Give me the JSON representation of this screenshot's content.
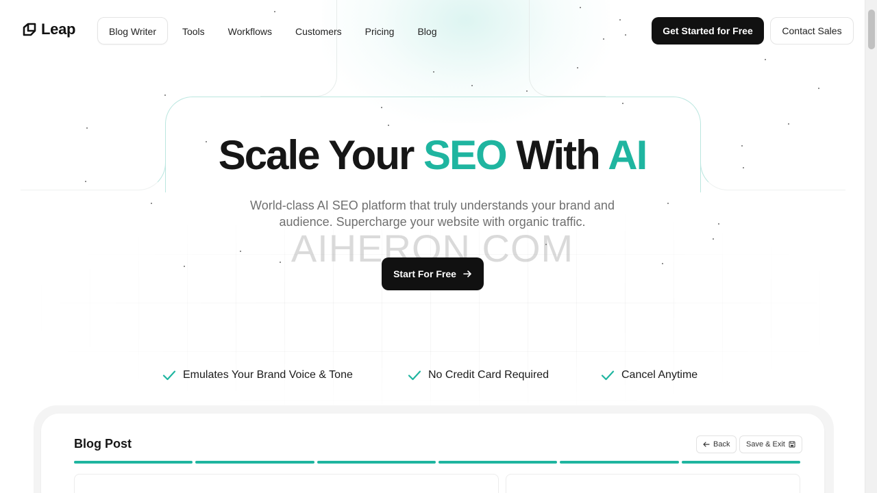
{
  "brand": {
    "name": "Leap",
    "accent_color": "#1fb5a0",
    "dark_color": "#111111"
  },
  "nav": {
    "items": [
      {
        "label": "Blog Writer"
      },
      {
        "label": "Tools"
      },
      {
        "label": "Workflows"
      },
      {
        "label": "Customers"
      },
      {
        "label": "Pricing"
      },
      {
        "label": "Blog"
      }
    ],
    "active_item": "Blog Writer",
    "cta_primary": "Get Started for Free",
    "cta_secondary": "Contact Sales"
  },
  "hero": {
    "title_part1": "Scale Your ",
    "title_accent1": "SEO",
    "title_part2": " With ",
    "title_accent2": "AI",
    "subtitle_line1": "World-class AI SEO platform that truly understands your brand and",
    "subtitle_line2": "audience. Supercharge your website with organic traffic.",
    "cta_label": "Start For Free",
    "cta_icon": "arrow-right-icon"
  },
  "watermark": "AIHERON.COM",
  "features": [
    {
      "label": "Emulates Your Brand Voice & Tone",
      "icon": "check-icon"
    },
    {
      "label": "No Credit Card Required",
      "icon": "check-icon"
    },
    {
      "label": "Cancel Anytime",
      "icon": "check-icon"
    }
  ],
  "preview": {
    "title": "Blog Post",
    "back_label": "Back",
    "save_label": "Save & Exit",
    "progress_steps_completed": 6,
    "progress_steps_total": 6
  }
}
